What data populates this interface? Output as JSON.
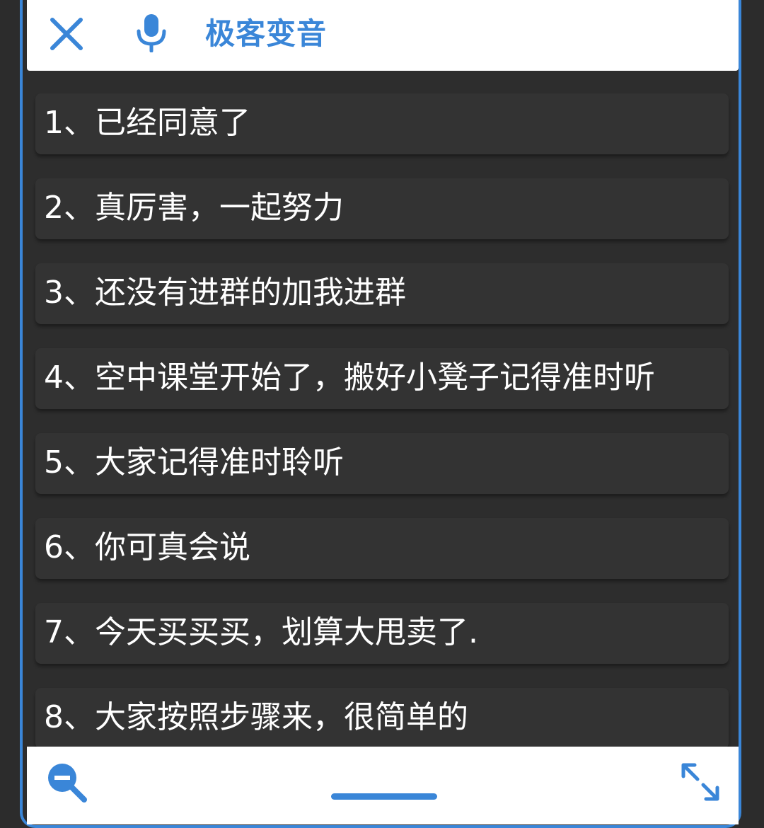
{
  "header": {
    "title": "极客变音",
    "close_icon": "close-icon",
    "mic_icon": "microphone-icon"
  },
  "list": {
    "items": [
      {
        "label": "1、已经同意了"
      },
      {
        "label": "2、真厉害，一起努力"
      },
      {
        "label": "3、还没有进群的加我进群"
      },
      {
        "label": "4、空中课堂开始了，搬好小凳子记得准时听"
      },
      {
        "label": "5、大家记得准时聆听"
      },
      {
        "label": "6、你可真会说"
      },
      {
        "label": "7、今天买买买，划算大甩卖了."
      },
      {
        "label": "8、大家按照步骤来，很简单的"
      }
    ]
  },
  "footer": {
    "zoom_icon": "zoom-out-icon",
    "expand_icon": "expand-icon"
  },
  "colors": {
    "accent": "#3a86d8",
    "background": "#2d2d2d",
    "item_background": "#333333",
    "text": "#ffffff"
  }
}
